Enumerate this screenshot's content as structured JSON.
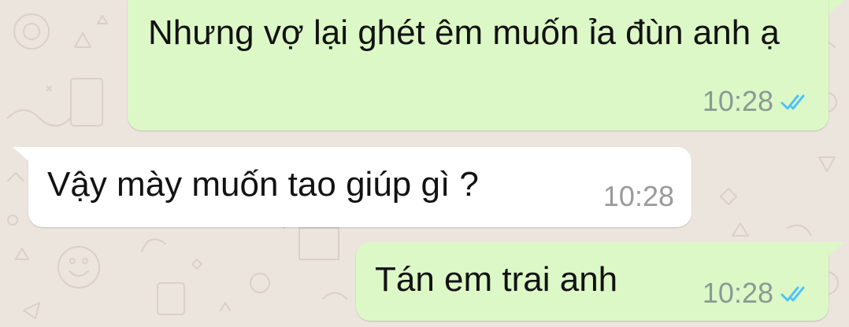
{
  "chat": {
    "messages": [
      {
        "direction": "outgoing",
        "text": "Nhưng vợ lại ghét êm muốn ỉa đùn anh ạ",
        "time": "10:28",
        "status_icon": "double-check-read-icon"
      },
      {
        "direction": "incoming",
        "text": "Vậy mày muốn tao giúp gì ?",
        "time": "10:28"
      },
      {
        "direction": "outgoing",
        "text": "Tán em trai anh",
        "time": "10:28",
        "status_icon": "double-check-read-icon"
      }
    ]
  },
  "colors": {
    "wallpaper": "#ece5dd",
    "outgoing_bubble": "#dcf8c6",
    "incoming_bubble": "#ffffff",
    "read_ticks": "#4fc3f7",
    "timestamp": "#8b9a95"
  }
}
